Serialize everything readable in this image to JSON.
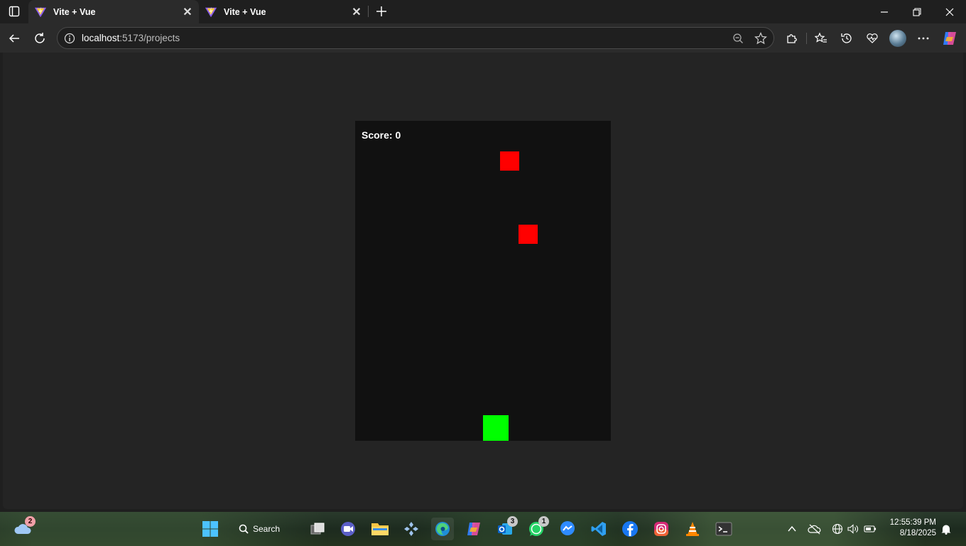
{
  "tabs": [
    {
      "title": "Vite + Vue",
      "active": true
    },
    {
      "title": "Vite + Vue",
      "active": false
    }
  ],
  "address": {
    "host": "localhost",
    "rest": ":5173/projects"
  },
  "game": {
    "score_label": "Score:",
    "score_value": "0"
  },
  "colors": {
    "player": "#00ff00",
    "obstacle": "#ff0000",
    "board": "#111111",
    "page_background": "#242424"
  },
  "taskbar": {
    "weather_badge": "2",
    "search_label": "Search",
    "outlook_badge": "3",
    "whatsapp_badge": "1",
    "time": "12:55:39 PM",
    "date": "8/18/2025"
  }
}
